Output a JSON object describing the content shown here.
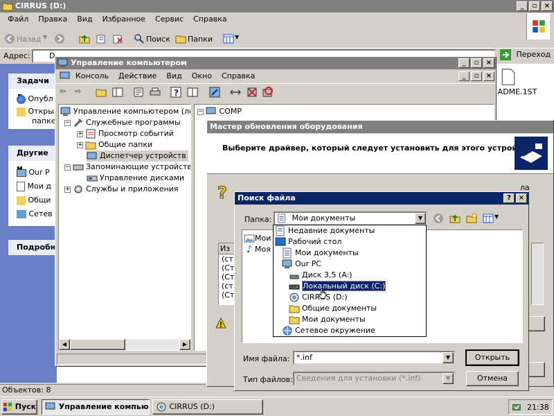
{
  "explorer": {
    "title": "CIRRUS (D:)",
    "menu": [
      "Файл",
      "Правка",
      "Вид",
      "Избранное",
      "Сервис",
      "Справка"
    ],
    "toolbar": {
      "back": "Назад",
      "search": "Поиск",
      "folders": "Папки"
    },
    "address_label": "Адрес:",
    "address_value": "D",
    "go_label": "Переход",
    "tasks_header": "Задачи д",
    "tasks": [
      "Опубл",
      "Откры",
      "папке"
    ],
    "other_header": "Другие м",
    "other_items": [
      "Our P",
      "Мои д",
      "Общи",
      "Сетев"
    ],
    "details_header": "Подробн",
    "file_label": "ADME.1ST",
    "status": "Объектов: 8"
  },
  "mmc": {
    "title": "Управление компьютером",
    "menu": [
      "Консоль",
      "Действие",
      "Вид",
      "Окно",
      "Справка"
    ],
    "tree": {
      "root": "Управление компьютером (локаль",
      "system_tools": "Служебные программы",
      "event_viewer": "Просмотр событий",
      "shared_folders": "Общие папки",
      "device_manager": "Диспетчер устройств",
      "storage": "Запоминающие устройства",
      "disk_mgmt": "Управление дисками",
      "services": "Службы и приложения"
    },
    "right_item": "COMP"
  },
  "wizard": {
    "title": "Мастер обновления оборудования",
    "heading": "Выберите драйвер, который следует установить для этого устройства.",
    "partial_rows": [
      "(ст",
      "(Ст",
      "(Ст",
      "(ст",
      "(Ст"
    ],
    "col_header": "Из",
    "right_label": "ла"
  },
  "open_dialog": {
    "title": "Поиск файла",
    "folder_label": "Папка:",
    "folder_value": "Мои документы",
    "files": [
      "Мои р",
      "Моя м"
    ],
    "dropdown": [
      {
        "label": "Недавние документы",
        "icon": "recent-docs-icon",
        "indent": 0
      },
      {
        "label": "Рабочий стол",
        "icon": "desktop-icon",
        "indent": 0
      },
      {
        "label": "Мои документы",
        "icon": "documents-icon",
        "indent": 1
      },
      {
        "label": "Our PC",
        "icon": "computer-icon",
        "indent": 1
      },
      {
        "label": "Диск 3,5 (A:)",
        "icon": "floppy-icon",
        "indent": 2
      },
      {
        "label": "Локальный диск (C:)",
        "icon": "hard-drive-icon",
        "indent": 2,
        "selected": true
      },
      {
        "label": "CIRRUS (D:)",
        "icon": "cd-drive-icon",
        "indent": 2
      },
      {
        "label": "Общие документы",
        "icon": "folder-icon",
        "indent": 2
      },
      {
        "label": "Мои документы",
        "icon": "folder-icon",
        "indent": 2
      },
      {
        "label": "Сетевое окружение",
        "icon": "network-icon",
        "indent": 1
      }
    ],
    "filename_label": "Имя файла:",
    "filename_value": "*.inf",
    "filetype_label": "Тип файлов:",
    "filetype_value": "Сведения для установки (*.inf)",
    "open_button": "Открыть",
    "cancel_button": "Отмена"
  },
  "taskbar": {
    "start": "Пуск",
    "tasks": [
      "Управление компью...",
      "CIRRUS (D:)"
    ],
    "time": "21:38"
  }
}
